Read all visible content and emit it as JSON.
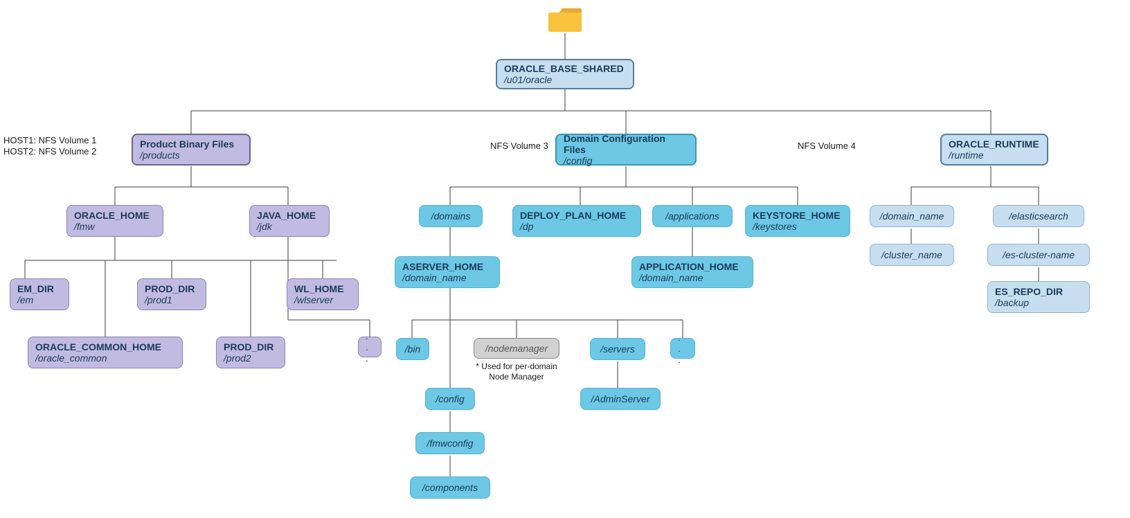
{
  "labels": {
    "host1": "HOST1: NFS Volume 1",
    "host2": "HOST2: NFS Volume 2",
    "nfs3": "NFS Volume 3",
    "nfs4": "NFS Volume 4",
    "nodemgr_note1": "* Used for per-domain",
    "nodemgr_note2": "Node Manager"
  },
  "n": {
    "root": {
      "title": "ORACLE_BASE_SHARED",
      "path": "/u01/oracle"
    },
    "products": {
      "title": "Product Binary Files",
      "path": "/products"
    },
    "oracle_home": {
      "title": "ORACLE_HOME",
      "path": "/fmw"
    },
    "java_home": {
      "title": "JAVA_HOME",
      "path": "/jdk"
    },
    "em_dir": {
      "title": "EM_DIR",
      "path": "/em"
    },
    "prod1": {
      "title": "PROD_DIR",
      "path": "/prod1"
    },
    "wl_home": {
      "title": "WL_HOME",
      "path": "/wlserver"
    },
    "oracle_common": {
      "title": "ORACLE_COMMON_HOME",
      "path": "/oracle_common"
    },
    "prod2": {
      "title": "PROD_DIR",
      "path": "/prod2"
    },
    "jdk_more": {
      "path": ". . ."
    },
    "config": {
      "title": "Domain Configuration Files",
      "path": "/config"
    },
    "domains": {
      "path": "/domains"
    },
    "deploy_plan": {
      "title": "DEPLOY_PLAN_HOME",
      "path": "/dp"
    },
    "applications": {
      "path": "/applications"
    },
    "keystore": {
      "title": "KEYSTORE_HOME",
      "path": "/keystores"
    },
    "aserver": {
      "title": "ASERVER_HOME",
      "path": "/domain_name"
    },
    "app_home": {
      "title": "APPLICATION_HOME",
      "path": "/domain_name"
    },
    "bin": {
      "path": "/bin"
    },
    "nodemanager": {
      "path": "/nodemanager"
    },
    "servers": {
      "path": "/servers"
    },
    "aserver_more": {
      "path": ". . ."
    },
    "adminserver": {
      "path": "/AdminServer"
    },
    "dconfig": {
      "path": "/config"
    },
    "fmwconfig": {
      "path": "/fmwconfig"
    },
    "components": {
      "path": "/components"
    },
    "runtime": {
      "title": "ORACLE_RUNTIME",
      "path": "/runtime"
    },
    "rt_domain": {
      "path": "/domain_name"
    },
    "rt_cluster": {
      "path": "/cluster_name"
    },
    "rt_es": {
      "path": "/elasticsearch"
    },
    "rt_escluster": {
      "path": "/es-cluster-name"
    },
    "rt_esrepo": {
      "title": "ES_REPO_DIR",
      "path": "/backup"
    }
  }
}
